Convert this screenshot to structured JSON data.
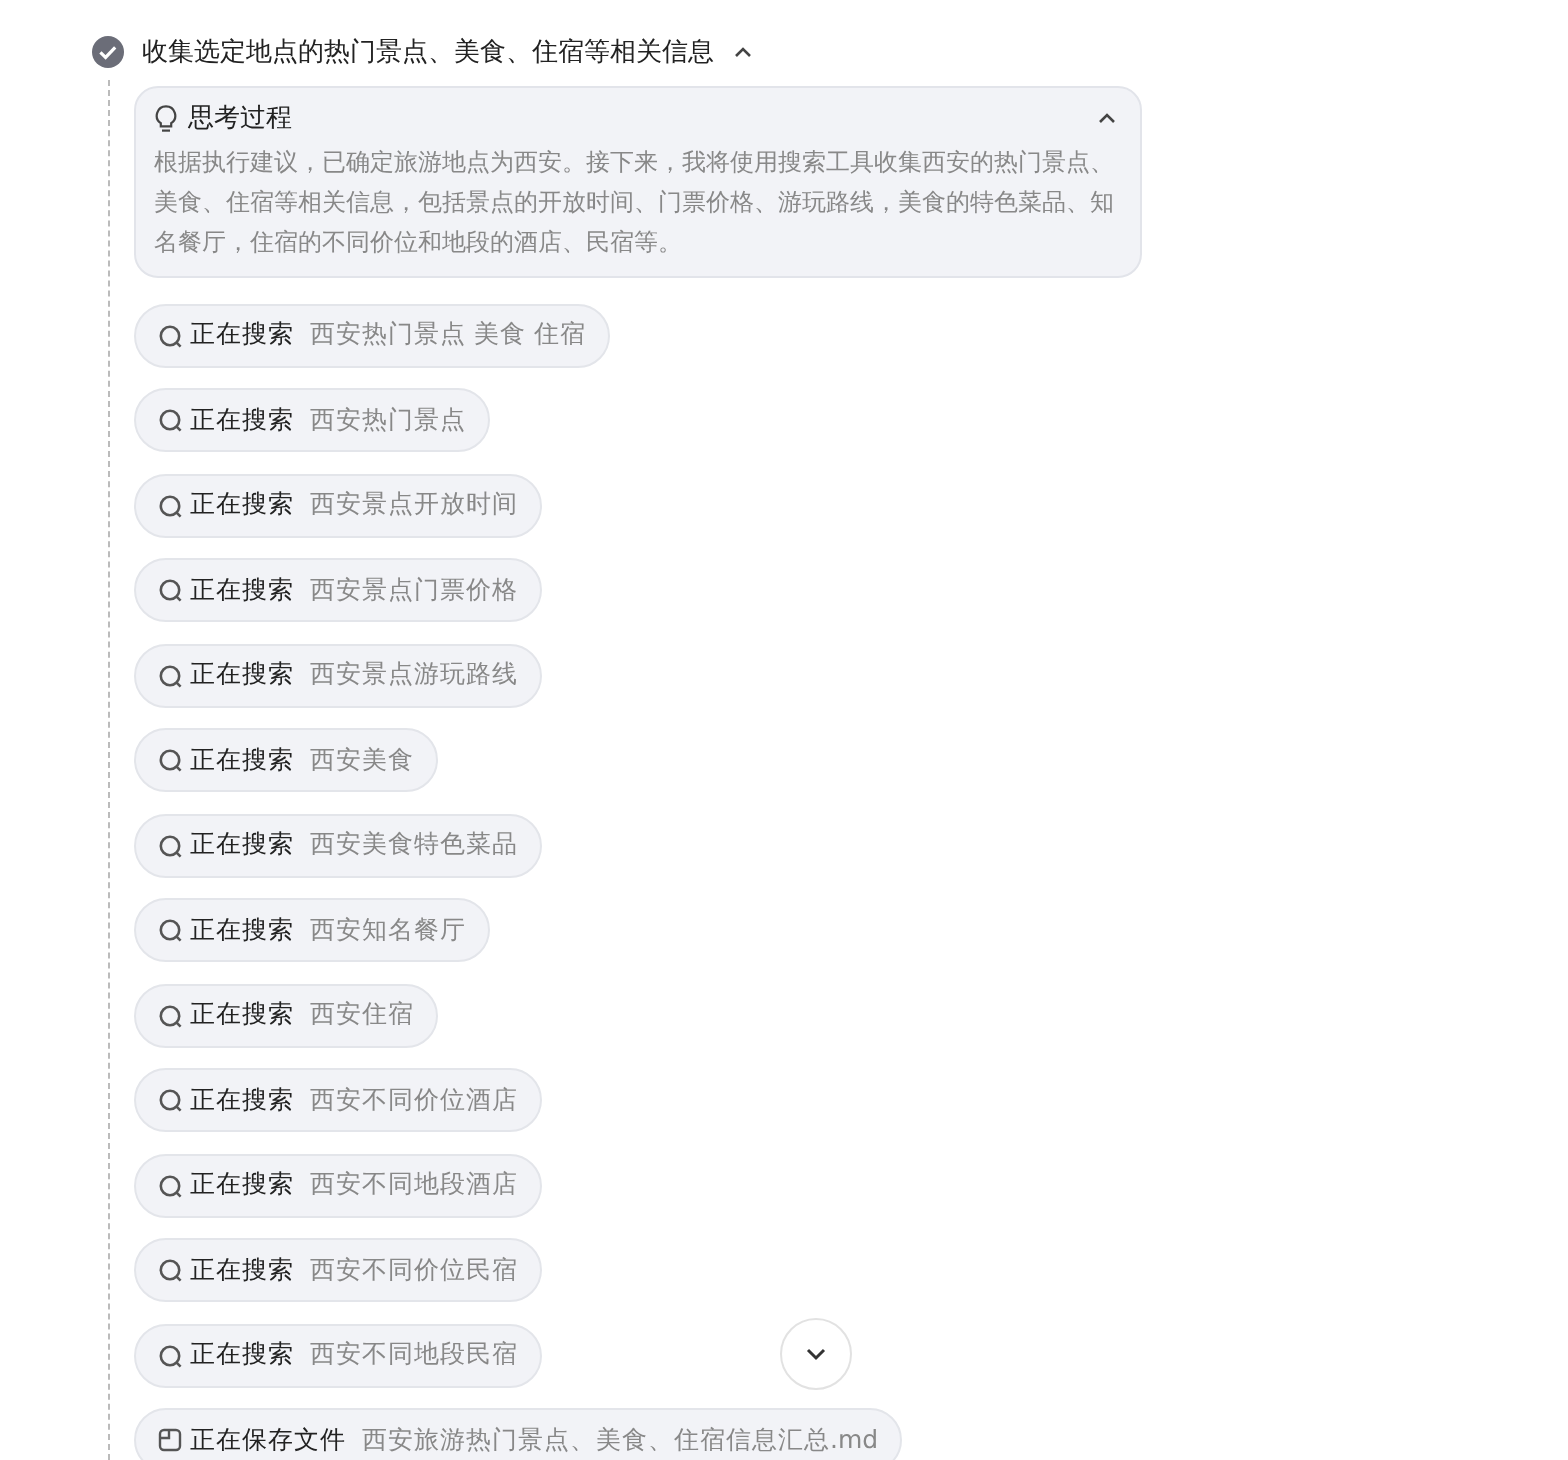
{
  "step": {
    "title": "收集选定地点的热门景点、美食、住宿等相关信息",
    "done": true,
    "expanded": true
  },
  "thinking": {
    "title": "思考过程",
    "expanded": true,
    "text": "根据执行建议，已确定旅游地点为西安。接下来，我将使用搜索工具收集西安的热门景点、美食、住宿等相关信息，包括景点的开放时间、门票价格、游玩路线，美食的特色菜品、知名餐厅，住宿的不同价位和地段的酒店、民宿等。"
  },
  "actions": [
    {
      "kind": "search",
      "label": "正在搜索",
      "query": "西安热门景点 美食 住宿"
    },
    {
      "kind": "search",
      "label": "正在搜索",
      "query": "西安热门景点"
    },
    {
      "kind": "search",
      "label": "正在搜索",
      "query": "西安景点开放时间"
    },
    {
      "kind": "search",
      "label": "正在搜索",
      "query": "西安景点门票价格"
    },
    {
      "kind": "search",
      "label": "正在搜索",
      "query": "西安景点游玩路线"
    },
    {
      "kind": "search",
      "label": "正在搜索",
      "query": "西安美食"
    },
    {
      "kind": "search",
      "label": "正在搜索",
      "query": "西安美食特色菜品"
    },
    {
      "kind": "search",
      "label": "正在搜索",
      "query": "西安知名餐厅"
    },
    {
      "kind": "search",
      "label": "正在搜索",
      "query": "西安住宿"
    },
    {
      "kind": "search",
      "label": "正在搜索",
      "query": "西安不同价位酒店"
    },
    {
      "kind": "search",
      "label": "正在搜索",
      "query": "西安不同地段酒店"
    },
    {
      "kind": "search",
      "label": "正在搜索",
      "query": "西安不同价位民宿"
    },
    {
      "kind": "search",
      "label": "正在搜索",
      "query": "西安不同地段民宿"
    },
    {
      "kind": "save",
      "label": "正在保存文件",
      "query": "西安旅游热门景点、美食、住宿信息汇总.md"
    }
  ]
}
